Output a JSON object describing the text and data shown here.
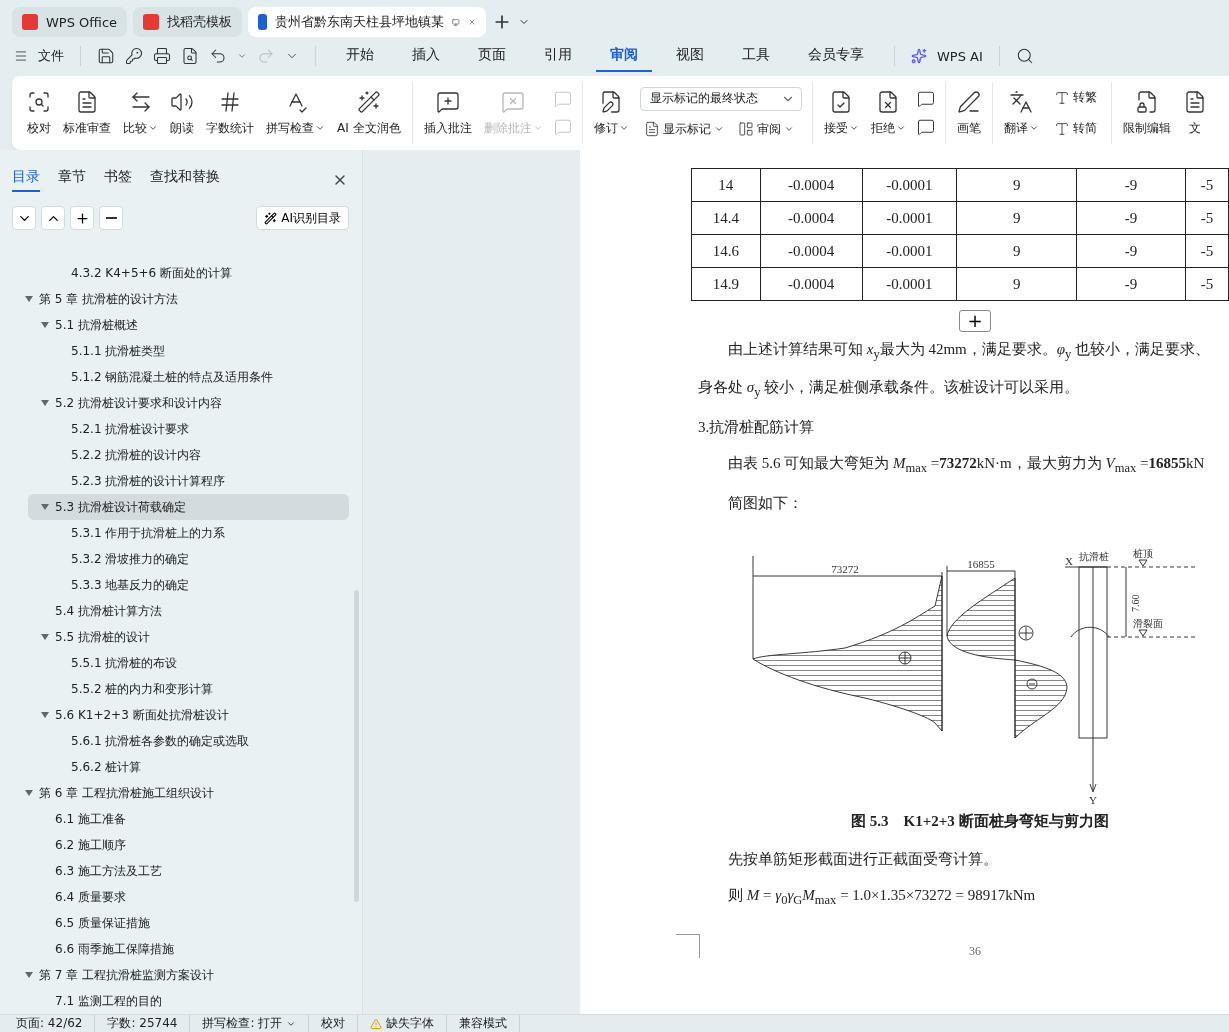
{
  "browser_tabs": [
    {
      "label": "WPS Office",
      "selected": false
    },
    {
      "label": "找稻壳模板",
      "selected": false
    },
    {
      "label": "贵州省黔东南天柱县坪地镇某",
      "selected": true
    }
  ],
  "menu": {
    "file": "文件",
    "tabs": [
      {
        "label": "开始",
        "selected": false
      },
      {
        "label": "插入",
        "selected": false
      },
      {
        "label": "页面",
        "selected": false
      },
      {
        "label": "引用",
        "selected": false
      },
      {
        "label": "审阅",
        "selected": true
      },
      {
        "label": "视图",
        "selected": false
      },
      {
        "label": "工具",
        "selected": false
      },
      {
        "label": "会员专享",
        "selected": false
      }
    ],
    "ai": "WPS AI"
  },
  "ribbon": {
    "groups": [
      {
        "items": [
          {
            "kind": "large",
            "label": "校对",
            "dropdown": false,
            "disabled": false
          },
          {
            "kind": "large",
            "label": "标准审查",
            "dropdown": false,
            "disabled": false
          },
          {
            "kind": "large",
            "label": "比较",
            "dropdown": true,
            "disabled": false
          },
          {
            "kind": "large",
            "label": "朗读",
            "dropdown": false,
            "disabled": false
          },
          {
            "kind": "large",
            "label": "字数统计",
            "dropdown": false,
            "disabled": false
          },
          {
            "kind": "large",
            "label": "拼写检查",
            "dropdown": true,
            "disabled": false
          },
          {
            "kind": "large",
            "label": "AI 全文润色",
            "dropdown": false,
            "disabled": false
          }
        ]
      },
      {
        "items": [
          {
            "kind": "large",
            "label": "插入批注",
            "dropdown": false,
            "disabled": false
          },
          {
            "kind": "large",
            "label": "删除批注",
            "dropdown": true,
            "disabled": true
          },
          {
            "kind": "stack",
            "items": [
              {
                "kind": "small",
                "disabled": true
              },
              {
                "kind": "small",
                "disabled": true
              }
            ]
          }
        ]
      },
      {
        "items": [
          {
            "kind": "large",
            "label": "修订",
            "dropdown": true,
            "disabled": false
          },
          {
            "kind": "panel",
            "value": "显示标记的最终状态",
            "items": [
              {
                "kind": "inline",
                "label": "显示标记",
                "dropdown": true,
                "disabled": false
              },
              {
                "kind": "inline",
                "label": "审阅",
                "dropdown": true,
                "disabled": false
              }
            ]
          }
        ]
      },
      {
        "items": [
          {
            "kind": "large",
            "label": "接受",
            "dropdown": true,
            "disabled": false
          },
          {
            "kind": "large",
            "label": "拒绝",
            "dropdown": true,
            "disabled": false
          },
          {
            "kind": "stack",
            "items": [
              {
                "kind": "small",
                "disabled": false
              },
              {
                "kind": "small",
                "disabled": false
              }
            ]
          }
        ]
      },
      {
        "items": [
          {
            "kind": "large",
            "label": "画笔",
            "dropdown": false,
            "disabled": false
          }
        ]
      },
      {
        "items": [
          {
            "kind": "large",
            "label": "翻译",
            "dropdown": true,
            "disabled": false
          },
          {
            "kind": "stack",
            "items": [
              {
                "kind": "inline",
                "label": "转繁",
                "dropdown": false,
                "disabled": false
              },
              {
                "kind": "inline",
                "label": "转简",
                "dropdown": false,
                "disabled": false
              }
            ]
          }
        ]
      },
      {
        "items": [
          {
            "kind": "large",
            "label": "限制编辑",
            "dropdown": false,
            "disabled": false
          },
          {
            "kind": "large",
            "label": "文",
            "dropdown": false,
            "disabled": false
          }
        ]
      }
    ]
  },
  "sidebar": {
    "tabs": [
      {
        "label": "目录",
        "selected": true
      },
      {
        "label": "章节",
        "selected": false
      },
      {
        "label": "书签",
        "selected": false
      },
      {
        "label": "查找和替换",
        "selected": false
      }
    ],
    "ai_button": "AI识别目录",
    "toc": [
      {
        "children": [
          {
            "children": [
              {
                "label": "4.3.2 K4+5+6 断面处的计算",
                "selected": false
              }
            ]
          }
        ]
      },
      {
        "label": "第 5 章  抗滑桩的设计方法",
        "selected": false,
        "expanded": true,
        "children": [
          {
            "label": "5.1  抗滑桩概述",
            "selected": false,
            "expanded": true,
            "children": [
              {
                "label": "5.1.1  抗滑桩类型",
                "selected": false
              },
              {
                "label": "5.1.2  钢筋混凝土桩的特点及适用条件",
                "selected": false
              }
            ]
          },
          {
            "label": "5.2  抗滑桩设计要求和设计内容",
            "selected": false,
            "expanded": true,
            "children": [
              {
                "label": "5.2.1  抗滑桩设计要求",
                "selected": false
              },
              {
                "label": "5.2.2  抗滑桩的设计内容",
                "selected": false
              },
              {
                "label": "5.2.3  抗滑桩的设计计算程序",
                "selected": false
              }
            ]
          },
          {
            "label": "5.3  抗滑桩设计荷载确定",
            "selected": true,
            "expanded": true,
            "children": [
              {
                "label": "5.3.1  作用于抗滑桩上的力系",
                "selected": false
              },
              {
                "label": "5.3.2  滑坡推力的确定",
                "selected": false
              },
              {
                "label": "5.3.3  地基反力的确定",
                "selected": false
              }
            ]
          },
          {
            "label": "5.4  抗滑桩计算方法",
            "selected": false
          },
          {
            "label": "5.5  抗滑桩的设计",
            "selected": false,
            "expanded": true,
            "children": [
              {
                "label": "5.5.1  抗滑桩的布设",
                "selected": false
              },
              {
                "label": "5.5.2  桩的内力和变形计算",
                "selected": false
              }
            ]
          },
          {
            "label": "5.6 K1+2+3 断面处抗滑桩设计",
            "selected": false,
            "expanded": true,
            "children": [
              {
                "label": "5.6.1  抗滑桩各参数的确定或选取",
                "selected": false
              },
              {
                "label": "5.6.2  桩计算",
                "selected": false
              }
            ]
          }
        ]
      },
      {
        "label": "第 6 章  工程抗滑桩施工组织设计",
        "selected": false,
        "expanded": true,
        "children": [
          {
            "label": "6.1  施工准备",
            "selected": false
          },
          {
            "label": "6.2  施工顺序",
            "selected": false
          },
          {
            "label": "6.3 施工方法及工艺",
            "selected": false
          },
          {
            "label": "6.4  质量要求",
            "selected": false
          },
          {
            "label": "6.5  质量保证措施",
            "selected": false
          },
          {
            "label": "6.6  雨季施工保障措施",
            "selected": false
          }
        ]
      },
      {
        "label": "第 7 章  工程抗滑桩监测方案设计",
        "selected": false,
        "expanded": true,
        "children": [
          {
            "label": "7.1  监测工程的目的",
            "selected": false
          }
        ]
      }
    ]
  },
  "document": {
    "table": {
      "rows": [
        [
          "14",
          "-0.0004",
          "-0.0001",
          "9",
          "-9",
          "-5"
        ],
        [
          "14.4",
          "-0.0004",
          "-0.0001",
          "9",
          "-9",
          "-5"
        ],
        [
          "14.6",
          "-0.0004",
          "-0.0001",
          "9",
          "-9",
          "-5"
        ],
        [
          "14.9",
          "-0.0004",
          "-0.0001",
          "9",
          "-9",
          "-5"
        ]
      ]
    },
    "add_row": "+",
    "blocks": [
      {
        "kind": "indented",
        "text": "由上述计算结果可知 *x*$_{y}$最大为 42mm，满足要求。*φ*$_{y}$ 也较小，满足要求、"
      },
      {
        "kind": "plain",
        "text": "身各处 *σ*$_{y}$ 较小，满足桩侧承载条件。该桩设计可以采用。"
      },
      {
        "kind": "plain",
        "text": "3.抗滑桩配筋计算"
      },
      {
        "kind": "indented",
        "text": "由表 5.6 可知最大弯矩为 *M*$_{max}$ =**73272**kN·m，最大剪力为 *V*$_{max}$ =**16855**kN"
      },
      {
        "kind": "indented",
        "text": "简图如下："
      },
      {
        "kind": "figure",
        "moment": "73272",
        "shear": "16855",
        "x_axis": "X",
        "y_axis": "Y",
        "pile": "抗滑桩",
        "top": "桩顶",
        "depth": "7.60",
        "slip": "滑裂面"
      },
      {
        "kind": "caption",
        "text": "图 5.3　K1+2+3 断面桩身弯矩与剪力图"
      },
      {
        "kind": "indented",
        "text": "先按单筋矩形截面进行正截面受弯计算。"
      },
      {
        "kind": "indented",
        "text": "则 *M* = *γ*$_{0}$*γ*$_{G}$*M*$_{max}$ = 1.0×1.35×73272 = 98917kNm"
      },
      {
        "kind": "page_number",
        "text": "36"
      }
    ]
  },
  "status_bar": [
    {
      "kind": "text",
      "label": "页面: 42/62"
    },
    {
      "kind": "text",
      "label": "字数: 25744"
    },
    {
      "kind": "dropdown",
      "label": "拼写检查: 打开"
    },
    {
      "kind": "text",
      "label": "校对"
    },
    {
      "kind": "warning",
      "label": "缺失字体"
    },
    {
      "kind": "text",
      "label": "兼容模式"
    }
  ]
}
